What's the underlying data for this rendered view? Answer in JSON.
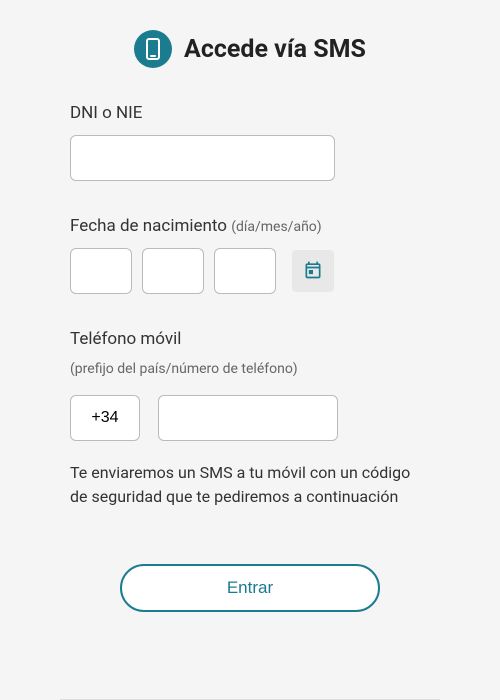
{
  "header": {
    "title": "Accede vía SMS"
  },
  "form": {
    "dni": {
      "label": "DNI o NIE",
      "value": ""
    },
    "dob": {
      "label": "Fecha de nacimiento ",
      "hint": "(día/mes/año)",
      "day": "",
      "month": "",
      "year": ""
    },
    "phone": {
      "label": "Teléfono móvil",
      "sublabel": "(prefijo del país/número de teléfono)",
      "prefix": "+34",
      "number": ""
    },
    "info": "Te enviaremos un SMS a tu móvil con un código de seguridad que te pediremos a continuación",
    "submit": "Entrar"
  },
  "colors": {
    "accent": "#1b7b8f"
  }
}
